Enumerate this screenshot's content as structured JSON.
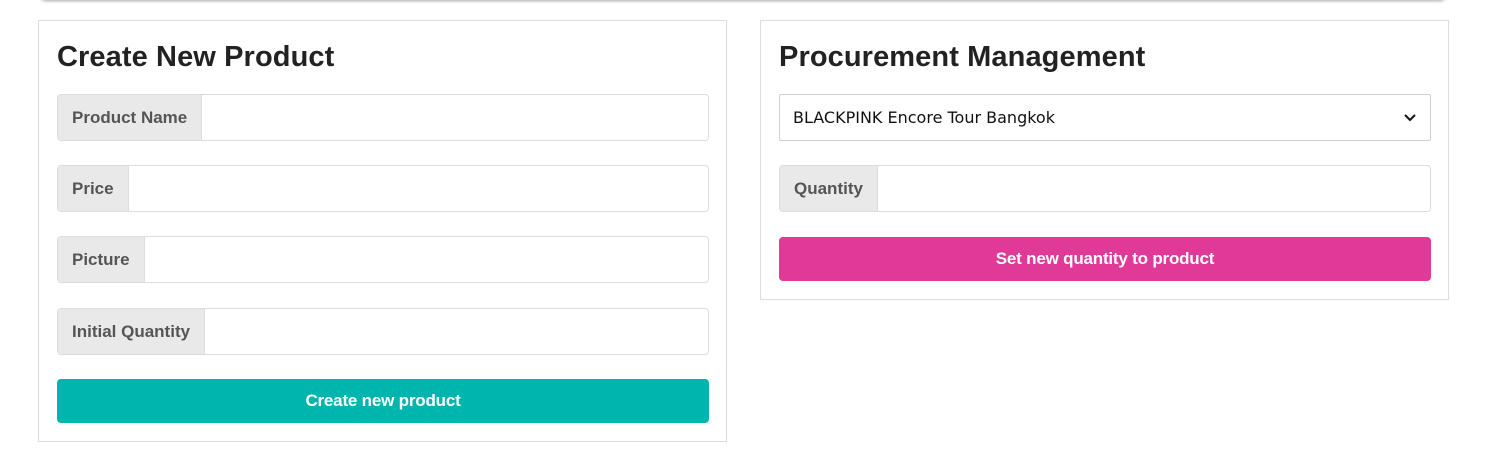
{
  "create_panel": {
    "title": "Create New Product",
    "fields": [
      {
        "label": "Product Name",
        "value": "",
        "placeholder": ""
      },
      {
        "label": "Price",
        "value": "",
        "placeholder": ""
      },
      {
        "label": "Picture",
        "value": "",
        "placeholder": ""
      },
      {
        "label": "Initial Quantity",
        "value": "",
        "placeholder": ""
      }
    ],
    "button_label": "Create new product",
    "button_color": "#00b5ad"
  },
  "procurement_panel": {
    "title": "Procurement Management",
    "selected_product": "BLACKPINK Encore Tour Bangkok",
    "quantity_label": "Quantity",
    "quantity_value": "",
    "button_label": "Set new quantity to product",
    "button_color": "#e03997"
  }
}
